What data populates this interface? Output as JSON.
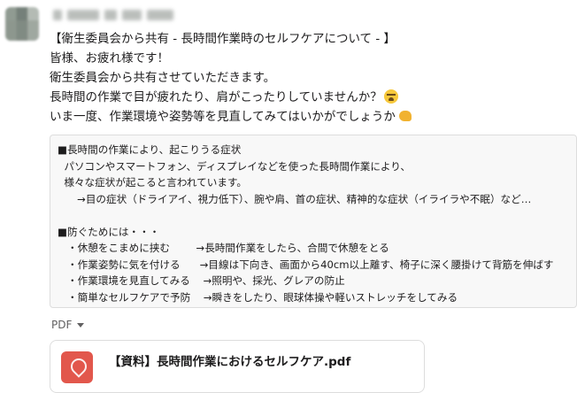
{
  "message": {
    "lines": [
      "【衛生委員会から共有 - 長時間作業時のセルフケアについて - 】",
      "皆様、お疲れ様です！",
      "衛生委員会から共有させていただきます。",
      "長時間の作業で目が疲れたり、肩がこったりしていませんか？",
      "いま一度、作業環境や姿勢等を見直してみてはいかがでしょうか"
    ],
    "emoji_line4": "tired-face-emoji",
    "emoji_line5": "flexed-biceps-emoji"
  },
  "codeblock": {
    "lines": [
      "■長時間の作業により、起こりうる症状",
      "  パソコンやスマートフォン、ディスプレイなどを使った長時間作業により、",
      "  様々な症状が起こると言われています。",
      "      →目の症状（ドライアイ、視力低下）、腕や肩、首の症状、精神的な症状（イライラや不眠）など…",
      "",
      "■防ぐためには・・・",
      "   ・休憩をこまめに挟む        →長時間作業をしたら、合間で休憩をとる",
      "   ・作業姿勢に気を付ける      →目線は下向き、画面から40cm以上離す、椅子に深く腰掛けて背筋を伸ばす",
      "   ・作業環境を見直してみる    →照明や、採光、グレアの防止",
      "   ・簡単なセルフケアで予防    →瞬きをしたり、眼球体操や軽いストレッチをしてみる"
    ]
  },
  "attachments": {
    "label": "PDF",
    "file_name": "【資料】長時間作業におけるセルフケア.pdf",
    "icon": "pdf-file-icon"
  }
}
